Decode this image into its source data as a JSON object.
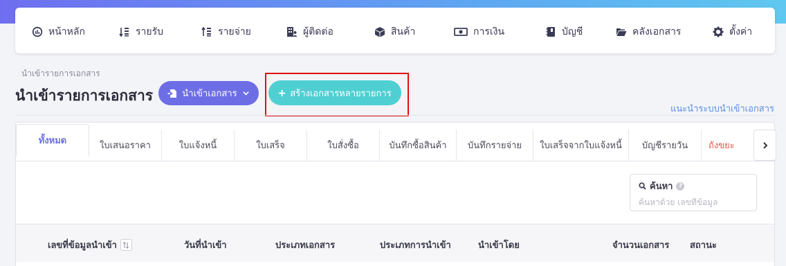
{
  "nav": {
    "items": [
      {
        "key": "home",
        "label": "หน้าหลัก",
        "icon": "dashboard-gauge-icon"
      },
      {
        "key": "income",
        "label": "รายรับ",
        "icon": "sort-list-icon"
      },
      {
        "key": "expense",
        "label": "รายจ่าย",
        "icon": "sort-list-icon"
      },
      {
        "key": "contacts",
        "label": "ผู้ติดต่อ",
        "icon": "contact-building-icon"
      },
      {
        "key": "products",
        "label": "สินค้า",
        "icon": "box-icon"
      },
      {
        "key": "finance",
        "label": "การเงิน",
        "icon": "money-bill-icon"
      },
      {
        "key": "accounting",
        "label": "บัญชี",
        "icon": "ledger-book-icon"
      },
      {
        "key": "docs",
        "label": "คลังเอกสาร",
        "icon": "folder-open-icon"
      },
      {
        "key": "settings",
        "label": "ตั้งค่า",
        "icon": "gear-icon"
      }
    ]
  },
  "header": {
    "breadcrumb": "นำเข้ารายการเอกสาร",
    "title": "นำเข้ารายการเอกสาร",
    "import_button": "นำเข้าเอกสาร",
    "create_button": "สร้างเอกสารหลายรายการ",
    "guide_link": "แนะนำระบบนำเข้าเอกสาร"
  },
  "tabs": [
    "ทั้งหมด",
    "ใบเสนอราคา",
    "ใบแจ้งหนี้",
    "ใบเสร็จ",
    "ใบสั่งซื้อ",
    "บันทึกซื้อสินค้า",
    "บันทึกรายจ่าย",
    "ใบเสร็จจากใบแจ้งหนี้",
    "บัญชีรายวัน",
    "ถังขยะ"
  ],
  "search": {
    "label": "ค้นหา",
    "placeholder": "ค้นหาด้วย เลขที่ข้อมูล",
    "value": ""
  },
  "table": {
    "columns": [
      "เลขที่ข้อมูลนำเข้า",
      "วันที่นำเข้า",
      "ประเภทเอกสาร",
      "ประเภทการนำเข้า",
      "นำเข้าโดย",
      "จำนวนเอกสาร",
      "สถานะ"
    ]
  },
  "colors": {
    "primary": "#6d6ee6",
    "accent": "#4fcfd2",
    "highlight": "#e01010",
    "link": "#5b8fe0",
    "trash": "#e05a4a"
  }
}
